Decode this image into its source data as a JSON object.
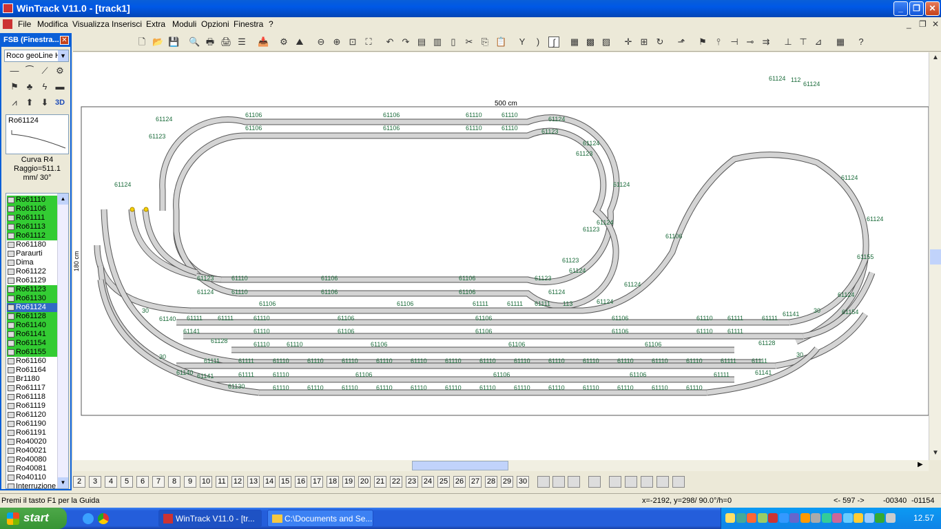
{
  "window": {
    "title": "WinTrack  V11.0 - [track1]"
  },
  "menu": [
    "File",
    "Modifica",
    "Visualizza",
    "Inserisci",
    "Extra",
    "Moduli",
    "Opzioni",
    "Finestra",
    "?"
  ],
  "fsb": {
    "title": "FSB (Finestra...",
    "library": "Roco geoLine H",
    "preview_name": "Ro61124",
    "info": [
      "Curva R4",
      "Raggio=511.1",
      "mm/ 30°"
    ],
    "items": [
      {
        "label": "Ro61110",
        "hl": true
      },
      {
        "label": "Ro61106",
        "hl": true
      },
      {
        "label": "Ro61111",
        "hl": true
      },
      {
        "label": "Ro61113",
        "hl": true
      },
      {
        "label": "Ro61112",
        "hl": true
      },
      {
        "label": "Ro61180",
        "hl": false
      },
      {
        "label": "Paraurti",
        "hl": false
      },
      {
        "label": "Dima",
        "hl": false
      },
      {
        "label": "Ro61122",
        "hl": false
      },
      {
        "label": "Ro61129",
        "hl": false
      },
      {
        "label": "Ro61123",
        "hl": true
      },
      {
        "label": "Ro61130",
        "hl": true
      },
      {
        "label": "Ro61124",
        "sel": true
      },
      {
        "label": "Ro61128",
        "hl": true
      },
      {
        "label": "Ro61140",
        "hl": true
      },
      {
        "label": "Ro61141",
        "hl": true
      },
      {
        "label": "Ro61154",
        "hl": true
      },
      {
        "label": "Ro61155",
        "hl": true
      },
      {
        "label": "Ro61160",
        "hl": false
      },
      {
        "label": "Ro61164",
        "hl": false
      },
      {
        "label": "Br1180",
        "hl": false
      },
      {
        "label": "Ro61117",
        "hl": false
      },
      {
        "label": "Ro61118",
        "hl": false
      },
      {
        "label": "Ro61119",
        "hl": false
      },
      {
        "label": "Ro61120",
        "hl": false
      },
      {
        "label": "Ro61190",
        "hl": false
      },
      {
        "label": "Ro61191",
        "hl": false
      },
      {
        "label": "Ro40020",
        "hl": false
      },
      {
        "label": "Ro40021",
        "hl": false
      },
      {
        "label": "Ro40080",
        "hl": false
      },
      {
        "label": "Ro40081",
        "hl": false
      },
      {
        "label": "Ro40110",
        "hl": false
      },
      {
        "label": "Interruzione",
        "hl": false
      }
    ]
  },
  "canvas": {
    "width_label": "500 cm",
    "height_label": "180 cm",
    "labels": {
      "a": "61106",
      "b": "61110",
      "c": "61124",
      "d": "61123",
      "e": "61111",
      "f": "112",
      "g": "113",
      "h": "30",
      "i": "61140",
      "j": "61128",
      "k": "61141",
      "l": "61155",
      "m": "61154",
      "n": "61130"
    }
  },
  "pages": [
    "2",
    "3",
    "4",
    "5",
    "6",
    "7",
    "8",
    "9",
    "10",
    "11",
    "12",
    "13",
    "14",
    "15",
    "16",
    "17",
    "18",
    "19",
    "20",
    "21",
    "22",
    "23",
    "24",
    "25",
    "26",
    "27",
    "28",
    "29",
    "30"
  ],
  "status": {
    "help": "Premi il tasto F1 per la Guida",
    "coords": "x=-2192, y=298/ 90.0°/h=0",
    "zoom": "<- 597 ->",
    "c1": "-00340",
    "c2": "-01154"
  },
  "taskbar": {
    "start": "start",
    "tasks": [
      "WinTrack  V11.0 - [tr...",
      "C:\\Documents and Se..."
    ],
    "clock": "12.57"
  }
}
